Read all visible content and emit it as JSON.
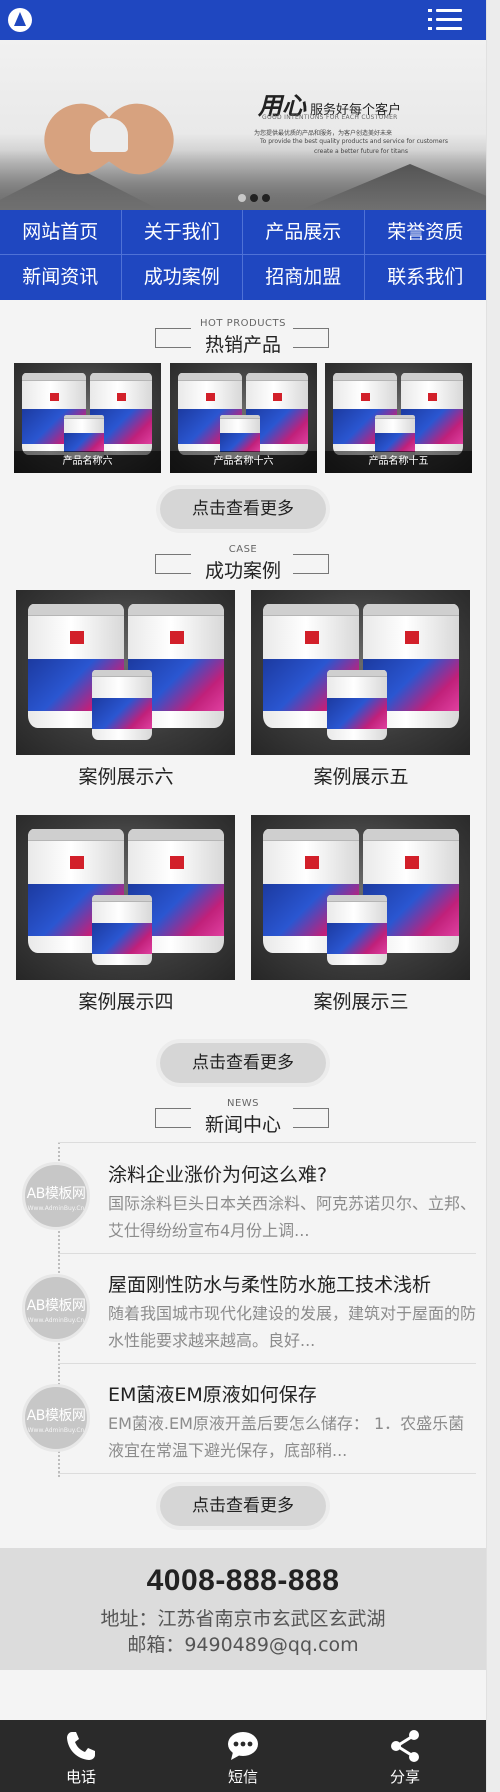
{
  "nav": {
    "items": [
      "网站首页",
      "关于我们",
      "产品展示",
      "荣誉资质",
      "新闻资讯",
      "成功案例",
      "招商加盟",
      "联系我们"
    ]
  },
  "banner": {
    "title_bold": "用心",
    "title": "服务好每个客户",
    "subtitle": "GOOD INTENTIONS FOR EACH CUSTOMER",
    "line1": "为您提供最优质的产品和服务，为客户创造美好未来",
    "line2": "To provide the best quality products and service for customers",
    "line3": "create a better future for titans"
  },
  "hot": {
    "en": "HOT PRODUCTS",
    "cn": "热销产品",
    "items": [
      "产品名称六",
      "产品名称十六",
      "产品名称十五"
    ],
    "more": "点击查看更多"
  },
  "cases": {
    "en": "CASE",
    "cn": "成功案例",
    "items": [
      "案例展示六",
      "案例展示五",
      "案例展示四",
      "案例展示三"
    ],
    "more": "点击查看更多"
  },
  "news": {
    "en": "NEWS",
    "cn": "新闻中心",
    "avatar_text": "AB模板网",
    "avatar_sub": "Www.AdminBuy.Cn",
    "items": [
      {
        "title": "涂料企业涨价为何这么难?",
        "desc": "国际涂料巨头日本关西涂料、阿克苏诺贝尔、立邦、艾仕得纷纷宣布4月份上调..."
      },
      {
        "title": "屋面刚性防水与柔性防水施工技术浅析",
        "desc": "随着我国城市现代化建设的发展，建筑对于屋面的防水性能要求越来越高。良好..."
      },
      {
        "title": "EM菌液EM原液如何保存",
        "desc": "EM菌液.EM原液开盖后要怎么储存： 1．农盛乐菌液宜在常温下避光保存，底部稍..."
      }
    ],
    "more": "点击查看更多"
  },
  "contact": {
    "phone": "4008-888-888",
    "address": "地址：江苏省南京市玄武区玄武湖",
    "email": "邮箱：9490489@qq.com"
  },
  "footer": {
    "items": [
      {
        "label": "电话",
        "icon": "phone-icon"
      },
      {
        "label": "短信",
        "icon": "message-icon"
      },
      {
        "label": "分享",
        "icon": "share-icon"
      }
    ]
  },
  "colors": {
    "brand": "#1f47c0",
    "footer": "#2a2a2a"
  }
}
